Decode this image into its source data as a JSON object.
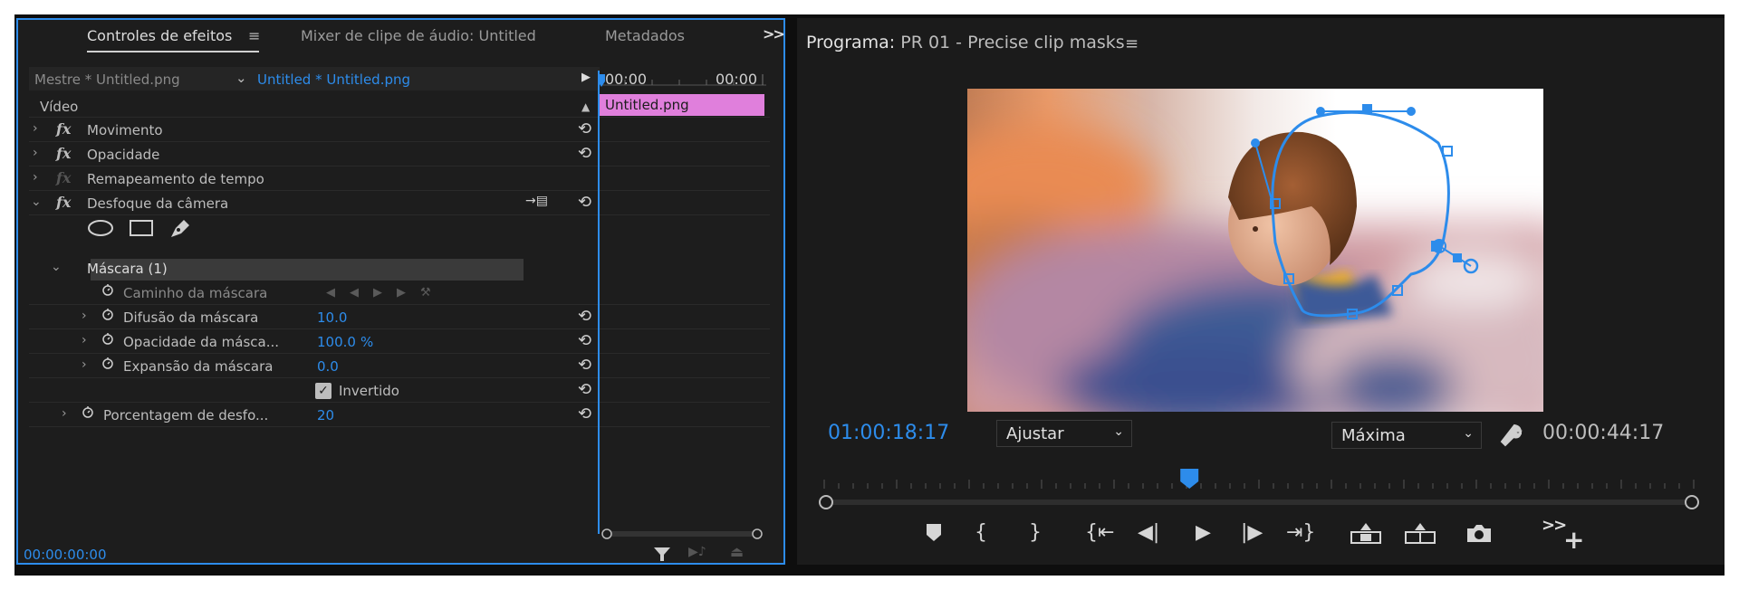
{
  "effect_controls": {
    "tabs": [
      {
        "label": "Controles de efeitos",
        "active": true
      },
      {
        "label": "Mixer de clipe de áudio: Untitled",
        "active": false
      },
      {
        "label": "Metadados",
        "active": false
      }
    ],
    "source_master": "Mestre * Untitled.png",
    "source_clip": "Untitled * Untitled.png",
    "section_video": "Vídeo",
    "effects": {
      "movimento": "Movimento",
      "opacidade": "Opacidade",
      "remapeamento": "Remapeamento de tempo",
      "desfoque": "Desfoque da câmera"
    },
    "mask": {
      "header": "Máscara (1)",
      "path_label": "Caminho da máscara",
      "feather_label": "Difusão da máscara",
      "feather_value": "10.0",
      "opacity_label": "Opacidade da másca...",
      "opacity_value": "100.0",
      "opacity_unit": "%",
      "expansion_label": "Expansão da máscara",
      "expansion_value": "0.0",
      "inverted_label": "Invertido",
      "inverted_checked": true
    },
    "blur_percent_label": "Porcentagem de desfo...",
    "blur_percent_value": "20",
    "timeline": {
      "start": "00:00",
      "end": "00:00",
      "clip_name": "Untitled.png"
    },
    "footer_timecode": "00:00:00:00"
  },
  "program_monitor": {
    "label": "Programa:",
    "sequence": "PR 01 - Precise clip masks",
    "timecode_current": "01:00:18:17",
    "zoom_label": "Ajustar",
    "quality_label": "Máxima",
    "timecode_duration": "00:00:44:17",
    "playhead_fraction": 0.42
  },
  "colors": {
    "accent": "#2d8ceb",
    "clip": "#e07fdc",
    "panel": "#1d1d1d"
  },
  "icons": [
    "menu-icon",
    "more-panels-icon",
    "chevron-down-icon",
    "play-triangle-icon",
    "reset-icon",
    "stopwatch-icon",
    "ellipse-mask-icon",
    "rectangle-mask-icon",
    "pen-mask-icon",
    "filter-icon",
    "wrench-icon",
    "marker-icon",
    "mark-in-icon",
    "mark-out-icon",
    "go-to-in-icon",
    "step-back-icon",
    "play-icon",
    "step-forward-icon",
    "go-to-out-icon",
    "lift-icon",
    "extract-icon",
    "camera-icon",
    "add-icon"
  ]
}
